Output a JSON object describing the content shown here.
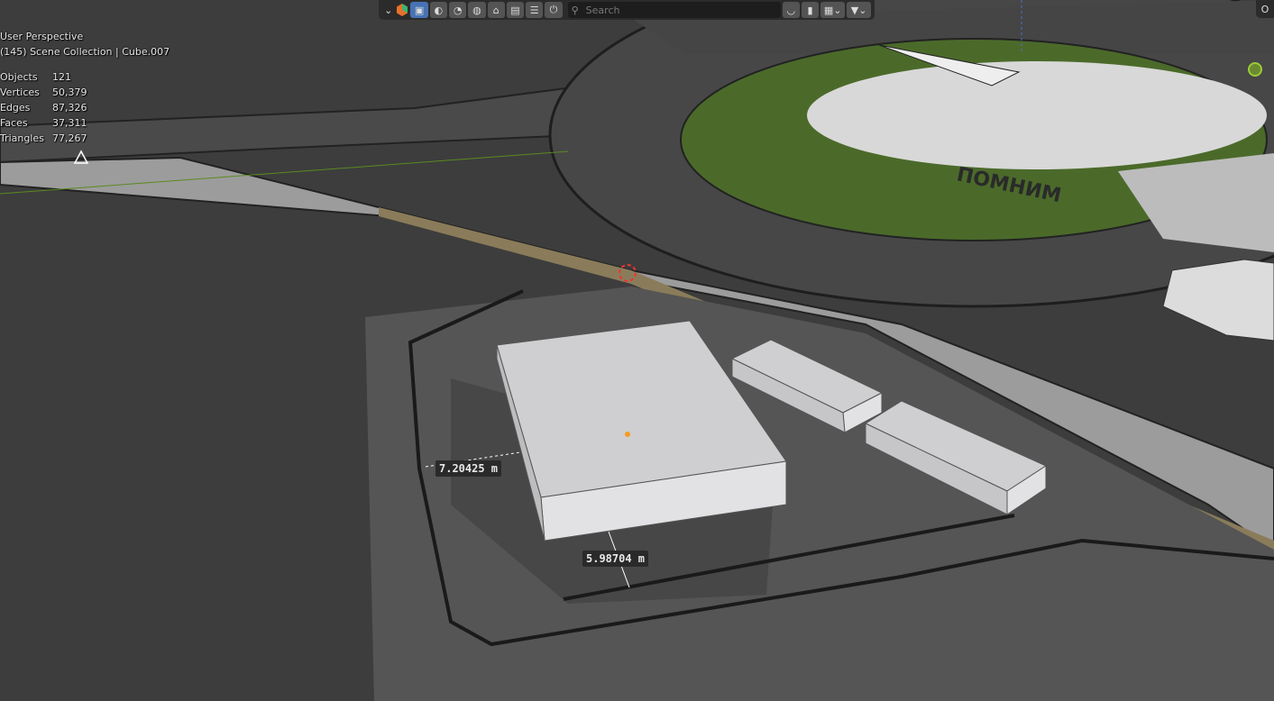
{
  "viewport": {
    "view_name": "User Perspective",
    "collection_info": "(145) Scene Collection | Cube.007",
    "stats": [
      {
        "label": "Objects",
        "value": "121"
      },
      {
        "label": "Vertices",
        "value": "50,379"
      },
      {
        "label": "Edges",
        "value": "87,326"
      },
      {
        "label": "Faces",
        "value": "37,311"
      },
      {
        "label": "Triangles",
        "value": "77,267"
      }
    ],
    "measurements": {
      "width": "7.20425 m",
      "depth": "5.98704 m"
    },
    "scene_text": "ПОМНИМ"
  },
  "header": {
    "search_placeholder": "Search",
    "filter_icons": [
      "selectable-icon",
      "viewport-visibility-icon",
      "render-visibility-icon",
      "holdout-icon",
      "world-icon",
      "brush-icon",
      "scene-icon",
      "sequencer-icon",
      "library-override-icon"
    ],
    "corner_label": "O"
  },
  "colors": {
    "accent": "#4772b3",
    "grass": "#4b6a2a",
    "background": "#3d3d3d"
  }
}
